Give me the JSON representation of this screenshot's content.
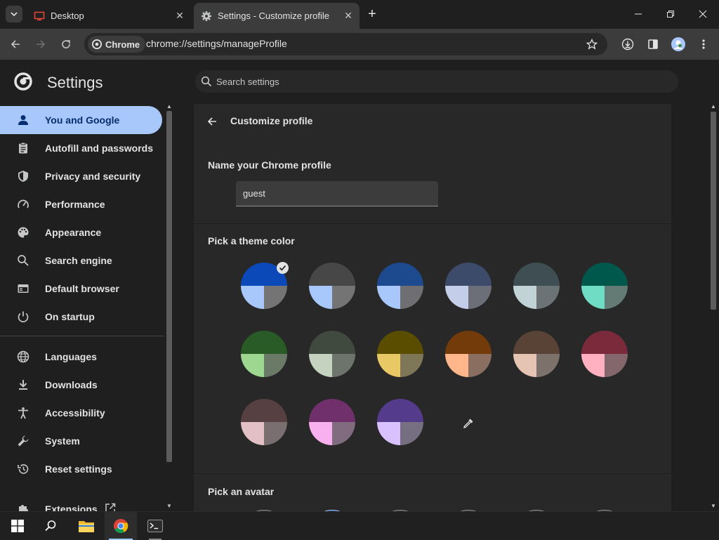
{
  "tabs": [
    {
      "title": "Desktop",
      "active": false,
      "favicon": "desktop-icon"
    },
    {
      "title": "Settings - Customize profile",
      "active": true,
      "favicon": "gear-icon"
    }
  ],
  "omnibox": {
    "chip_label": "Chrome",
    "url": "chrome://settings/manageProfile"
  },
  "header": {
    "title": "Settings",
    "search_placeholder": "Search settings"
  },
  "sidebar": {
    "items": [
      {
        "label": "You and Google",
        "icon": "person-icon",
        "selected": true
      },
      {
        "label": "Autofill and passwords",
        "icon": "clipboard-icon"
      },
      {
        "label": "Privacy and security",
        "icon": "shield-icon"
      },
      {
        "label": "Performance",
        "icon": "gauge-icon"
      },
      {
        "label": "Appearance",
        "icon": "palette-icon"
      },
      {
        "label": "Search engine",
        "icon": "search-icon"
      },
      {
        "label": "Default browser",
        "icon": "browser-icon"
      },
      {
        "label": "On startup",
        "icon": "power-icon"
      },
      {
        "label": "Languages",
        "icon": "globe-icon"
      },
      {
        "label": "Downloads",
        "icon": "download-icon"
      },
      {
        "label": "Accessibility",
        "icon": "accessibility-icon"
      },
      {
        "label": "System",
        "icon": "wrench-icon"
      },
      {
        "label": "Reset settings",
        "icon": "history-icon"
      },
      {
        "label": "Extensions",
        "icon": "puzzle-icon"
      }
    ]
  },
  "main": {
    "title": "Customize profile",
    "name_section_label": "Name your Chrome profile",
    "profile_name": "guest",
    "theme_section_label": "Pick a theme color",
    "avatar_section_label": "Pick an avatar",
    "theme_colors": [
      {
        "top": "#0b49b8",
        "left": "#a8c7fa",
        "right": "#747474",
        "selected": true
      },
      {
        "top": "#474747",
        "left": "#a8c7fa",
        "right": "#747474"
      },
      {
        "top": "#1d4a8e",
        "left": "#a8c7fa",
        "right": "#6f6f73"
      },
      {
        "top": "#3d4b6a",
        "left": "#c4cee8",
        "right": "#6c6f78"
      },
      {
        "top": "#3e4e52",
        "left": "#c2d3d6",
        "right": "#6b7375"
      },
      {
        "top": "#00574b",
        "left": "#6fdcc4",
        "right": "#637a75"
      },
      {
        "top": "#285b26",
        "left": "#9ed78f",
        "right": "#6b7a67"
      },
      {
        "top": "#404a3e",
        "left": "#c5d2c0",
        "right": "#6d746b"
      },
      {
        "top": "#5a4d00",
        "left": "#e7c864",
        "right": "#7d7758"
      },
      {
        "top": "#743b0a",
        "left": "#ffb68a",
        "right": "#8a6f61"
      },
      {
        "top": "#594236",
        "left": "#e6c4b3",
        "right": "#7d716b"
      },
      {
        "top": "#7b2a3b",
        "left": "#ffb0c0",
        "right": "#84676d"
      },
      {
        "top": "#574042",
        "left": "#e2c0c3",
        "right": "#7a6f70"
      },
      {
        "top": "#70306b",
        "left": "#f8b0ee",
        "right": "#816b7f"
      },
      {
        "top": "#543b8c",
        "left": "#d9c0ff",
        "right": "#766f82"
      }
    ]
  }
}
